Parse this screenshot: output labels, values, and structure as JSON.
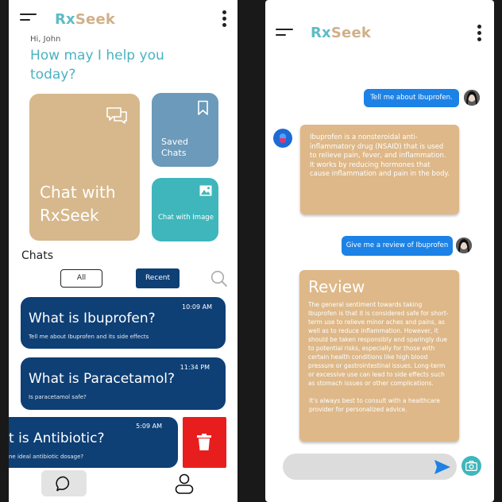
{
  "left": {
    "app": {
      "name_rx": "Rx",
      "name_seek": "Seek"
    },
    "greeting": {
      "hello": "Hi, John",
      "question": "How may I help you today?"
    },
    "cards": {
      "chat": "Chat with RxSeek",
      "saved": "Saved Chats",
      "image": "Chat with Image"
    },
    "chats": {
      "heading": "Chats",
      "filter_all": "All",
      "filter_recent": "Recent",
      "items": [
        {
          "title": "What is Ibuprofen?",
          "subtitle": "Tell me about Ibuprofen and its side effects",
          "time": "10:09 AM"
        },
        {
          "title": "What is Paracetamol?",
          "subtitle": "Is paracetamol safe?",
          "time": "11:34 PM"
        },
        {
          "title": "t is Antibiotic?",
          "subtitle": "ne ideal antibiotic dosage?",
          "time": "5:09 AM"
        }
      ]
    },
    "colors": {
      "accent": "#4ab3c0",
      "brown": "#d6b88c",
      "navy": "#0e3f75",
      "delete": "#e81e1e"
    }
  },
  "right": {
    "app": {
      "name_rx": "Rx",
      "name_seek": "Seek"
    },
    "messages": {
      "user1": "Tell me about Ibuprofen.",
      "bot1": "Ibuprofen is a nonsteroidal anti-inflammatory drug (NSAID) that is used to relieve pain, fever, and inflammation. It works by reducing hormones that cause inflammation and pain in the body.",
      "user2": "Give me a review of Ibuprofen",
      "review_title": "Review",
      "review_body": "The general sentiment towards taking Ibuprofen is that it is considered safe for short-term use to relieve minor aches and pains, as well as to reduce inflammation. However, it should be taken responsibly and sparingly due to potential risks, especially for those with certain health conditions like high blood pressure or gastrointestinal issues. Long-term or excessive use can lead to side effects such as stomach issues or other complications.",
      "review_footer": "It's always best to consult with a healthcare provider for personalized advice."
    },
    "input": {
      "placeholder": ""
    }
  }
}
